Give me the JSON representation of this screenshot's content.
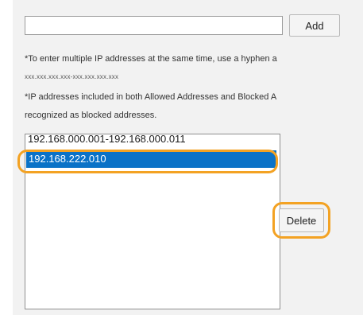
{
  "form": {
    "ip_input_value": "",
    "add_label": "Add",
    "note_multiple": "*To enter multiple IP addresses at the same time, use a hyphen a",
    "note_range_format": "xxx.xxx.xxx.xxx-xxx.xxx.xxx.xxx",
    "note_both_line1": "*IP addresses included in both Allowed Addresses and Blocked A",
    "note_both_line2": "recognized as blocked addresses."
  },
  "address_list": {
    "items": [
      {
        "text": "192.168.000.001-192.168.000.011",
        "selected": false
      },
      {
        "text": "192.168.222.010",
        "selected": true
      }
    ]
  },
  "actions": {
    "delete_label": "Delete"
  },
  "colors": {
    "selection": "#0a72c7",
    "highlight": "#f3a223"
  }
}
